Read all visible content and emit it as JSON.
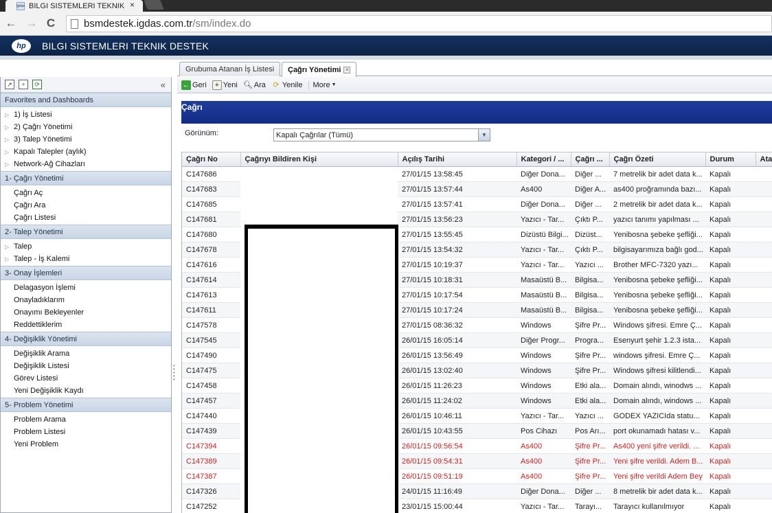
{
  "browser": {
    "tab_title": "BILGI SISTEMLERI TEKNIK",
    "tab_close": "×",
    "url_host": "bsmdestek.igdas.com.tr",
    "url_path": "/sm/index.do",
    "back_icon": "←",
    "forward_icon": "→",
    "reload_icon": "C"
  },
  "app": {
    "logo": "hp",
    "title": "BILGI SISTEMLERI TEKNIK DESTEK"
  },
  "left_panel": {
    "collapse": "«",
    "favorites": {
      "title": "Favorites and Dashboards",
      "items": [
        "1) İş Listesi",
        "2) Çağrı Yönetimi",
        "3) Talep Yönetimi",
        "Kapalı Talepler (aylık)",
        "Network-Ağ Cihazları"
      ]
    },
    "cagri": {
      "title": "1- Çağrı Yönetimi",
      "items": [
        "Çağrı Aç",
        "Çağrı Ara",
        "Çağrı Listesi"
      ]
    },
    "talep": {
      "title": "2- Talep Yönetimi",
      "items": [
        "Talep",
        "Talep - İş Kalemi"
      ]
    },
    "onay": {
      "title": "3- Onay İşlemleri",
      "items": [
        "Delagasyon İşlemi",
        "Onayladıklarım",
        "Onayımı Bekleyenler",
        "Reddettiklerim"
      ]
    },
    "degisiklik": {
      "title": "4- Değişiklik Yönetimi",
      "items": [
        "Değişiklik Arama",
        "Değişiklik Listesi",
        "Görev Listesi",
        "Yeni Değişiklik Kaydı"
      ]
    },
    "problem": {
      "title": "5- Problem Yönetimi",
      "items": [
        "Problem Arama",
        "Problem Listesi",
        "Yeni Problem"
      ]
    }
  },
  "tabs": {
    "tab1": "Grubuma Atanan İş Listesi",
    "tab2": "Çağrı Yönetimi",
    "tab_close": "×"
  },
  "actions": {
    "geri": "Geri",
    "yeni": "Yeni",
    "ara": "Ara",
    "yenile": "Yenile",
    "more": "More"
  },
  "record": {
    "title": "Çağrı",
    "view_label": "Görünüm:",
    "view_value": "Kapalı Çağrılar (Tümü)"
  },
  "grid": {
    "columns": [
      "Çağrı No",
      "Çağrıyı Bildiren Kişi",
      "Açılış Tarihi",
      "Kategori / ...",
      "Çağrı ...",
      "Çağrı Özeti",
      "Durum",
      "Ata"
    ],
    "rows": [
      {
        "no": "C147686",
        "date": "27/01/15 13:58:45",
        "cat": "Diğer Dona...",
        "sub": "Diğer ...",
        "summary": "7 metrelik bir adet data k...",
        "status": "Kapalı",
        "red": false
      },
      {
        "no": "C147683",
        "date": "27/01/15 13:57:44",
        "cat": "As400",
        "sub": "Diğer A...",
        "summary": "as400 proğramında bazı...",
        "status": "Kapalı",
        "red": false
      },
      {
        "no": "C147685",
        "date": "27/01/15 13:57:41",
        "cat": "Diğer Dona...",
        "sub": "Diğer ...",
        "summary": "2 metrelik bir adet data k...",
        "status": "Kapalı",
        "red": false
      },
      {
        "no": "C147681",
        "date": "27/01/15 13:56:23",
        "cat": "Yazıcı - Tar...",
        "sub": "Çıktı P...",
        "summary": "yazıcı tanımı yapılması ...",
        "status": "Kapalı",
        "red": false
      },
      {
        "no": "C147680",
        "date": "27/01/15 13:55:45",
        "cat": "Dizüstü Bilgi...",
        "sub": "Dizüst...",
        "summary": "Yenibosna şebeke şefliği...",
        "status": "Kapalı",
        "red": false
      },
      {
        "no": "C147678",
        "date": "27/01/15 13:54:32",
        "cat": "Yazıcı - Tar...",
        "sub": "Çıktı P...",
        "summary": "bilgisayarımıza bağlı god...",
        "status": "Kapalı",
        "red": false
      },
      {
        "no": "C147616",
        "date": "27/01/15 10:19:37",
        "cat": "Yazıcı - Tar...",
        "sub": "Yazıcı ...",
        "summary": "Brother MFC-7320 yazı...",
        "status": "Kapalı",
        "red": false
      },
      {
        "no": "C147614",
        "date": "27/01/15 10:18:31",
        "cat": "Masaüstü B...",
        "sub": "Bilgisa...",
        "summary": "Yenibosna şebeke şefliği...",
        "status": "Kapalı",
        "red": false
      },
      {
        "no": "C147613",
        "date": "27/01/15 10:17:54",
        "cat": "Masaüstü B...",
        "sub": "Bilgisa...",
        "summary": "Yenibosna şebeke şefliği...",
        "status": "Kapalı",
        "red": false
      },
      {
        "no": "C147611",
        "date": "27/01/15 10:17:24",
        "cat": "Masaüstü B...",
        "sub": "Bilgisa...",
        "summary": "Yenibosna şebeke şefliği...",
        "status": "Kapalı",
        "red": false
      },
      {
        "no": "C147578",
        "date": "27/01/15 08:36:32",
        "cat": "Windows",
        "sub": "Şifre Pr...",
        "summary": "Windows şifresi. Emre Ç...",
        "status": "Kapalı",
        "red": false
      },
      {
        "no": "C147545",
        "date": "26/01/15 16:05:14",
        "cat": "Diğer Progr...",
        "sub": "Progra...",
        "summary": "Esenyurt şehir 1.2.3 ista...",
        "status": "Kapalı",
        "red": false
      },
      {
        "no": "C147490",
        "date": "26/01/15 13:56:49",
        "cat": "Windows",
        "sub": "Şifre Pr...",
        "summary": "windows şifresi. Emre Ç...",
        "status": "Kapalı",
        "red": false
      },
      {
        "no": "C147475",
        "date": "26/01/15 13:02:40",
        "cat": "Windows",
        "sub": "Şifre Pr...",
        "summary": "Windows şifresi kilitlendi...",
        "status": "Kapalı",
        "red": false
      },
      {
        "no": "C147458",
        "date": "26/01/15 11:26:23",
        "cat": "Windows",
        "sub": "Etki ala...",
        "summary": "Domain alındı, winodws ...",
        "status": "Kapalı",
        "red": false
      },
      {
        "no": "C147457",
        "date": "26/01/15 11:24:02",
        "cat": "Windows",
        "sub": "Etki ala...",
        "summary": "Domain alındı, windows ...",
        "status": "Kapalı",
        "red": false
      },
      {
        "no": "C147440",
        "date": "26/01/15 10:46:11",
        "cat": "Yazıcı - Tar...",
        "sub": "Yazıcı ...",
        "summary": "GODEX YAZICIda statu...",
        "status": "Kapalı",
        "red": false
      },
      {
        "no": "C147439",
        "date": "26/01/15 10:43:55",
        "cat": "Pos Cihazı",
        "sub": "Pos Arı...",
        "summary": "port okunamadı hatası v...",
        "status": "Kapalı",
        "red": false
      },
      {
        "no": "C147394",
        "date": "26/01/15 09:56:54",
        "cat": "As400",
        "sub": "Şifre Pr...",
        "summary": "As400 yeni şifre verildi. ...",
        "status": "Kapalı",
        "red": true
      },
      {
        "no": "C147389",
        "date": "26/01/15 09:54:31",
        "cat": "As400",
        "sub": "Şifre Pr...",
        "summary": "Yeni şifre verildi. Adem B...",
        "status": "Kapalı",
        "red": true
      },
      {
        "no": "C147387",
        "date": "26/01/15 09:51:19",
        "cat": "As400",
        "sub": "Şifre Pr...",
        "summary": "Yeni şifre verildi Adem Bey",
        "status": "Kapalı",
        "red": true
      },
      {
        "no": "C147326",
        "date": "24/01/15 11:16:49",
        "cat": "Diğer Dona...",
        "sub": "Diğer ...",
        "summary": "8 metrelik bir adet data k...",
        "status": "Kapalı",
        "red": false
      },
      {
        "no": "C147252",
        "date": "23/01/15 15:00:44",
        "cat": "Yazıcı - Tar...",
        "sub": "Tarayı...",
        "summary": "Tarayıcı kullanılmıyor",
        "status": "Kapalı",
        "red": false
      }
    ]
  }
}
